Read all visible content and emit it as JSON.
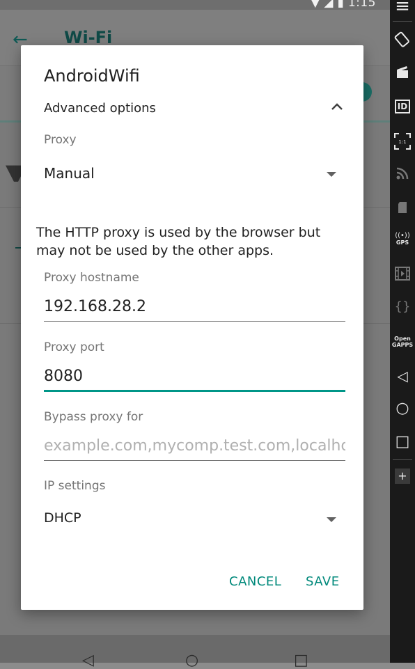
{
  "status_bar": {
    "time": "1:15"
  },
  "background_app": {
    "back_icon": "arrow-left-icon",
    "title": "Wi-Fi"
  },
  "dialog": {
    "title": "AndroidWifi",
    "advanced_options_label": "Advanced options",
    "proxy": {
      "label": "Proxy",
      "value": "Manual"
    },
    "info_text": "The HTTP proxy is used by the browser but may not be used by the other apps.",
    "proxy_hostname": {
      "label": "Proxy hostname",
      "value": "192.168.28.2"
    },
    "proxy_port": {
      "label": "Proxy port",
      "value": "8080"
    },
    "bypass": {
      "label": "Bypass proxy for",
      "placeholder": "example.com,mycomp.test.com,localhost"
    },
    "ip_settings": {
      "label": "IP settings",
      "value": "DHCP"
    },
    "cancel_label": "CANCEL",
    "save_label": "SAVE"
  },
  "toolbar": {
    "items": [
      "menu-icon",
      "rotate-icon",
      "clapper-icon",
      "id-icon",
      "fullscreen-icon",
      "rss-icon",
      "sdcard-icon",
      "gps-icon",
      "film-icon",
      "braces-icon",
      "opengapps-icon",
      "back-icon",
      "home-icon",
      "recents-icon",
      "plus-icon"
    ],
    "id_label": "ID",
    "scale_label": "1:1",
    "gps_label": "GPS",
    "opengapps_label": "Open GAPPS"
  },
  "colors": {
    "accent": "#009688",
    "button_text": "#00897b",
    "toolbar_bg": "#1a1a1a",
    "scrim": "#7a7a7a"
  }
}
